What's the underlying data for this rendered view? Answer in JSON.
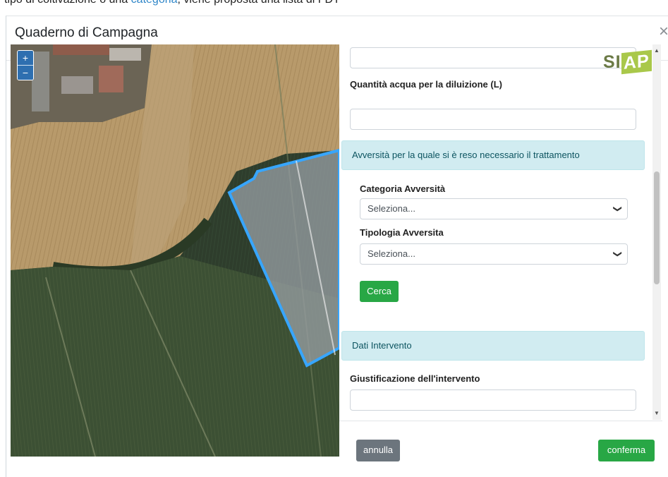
{
  "top_text": {
    "before": "tipo di coltivazione o una ",
    "link": "categoria",
    "after": ", viene proposta una lista di FDT"
  },
  "modal": {
    "title": "Quaderno di Campagna",
    "close_icon": "close-icon"
  },
  "map": {
    "zoom_in": "+",
    "zoom_out": "−"
  },
  "brand": {
    "logo_text_1": "SI",
    "logo_text_2": "AP"
  },
  "form": {
    "top_input_value": "",
    "water_label": "Quantità acqua per la diluizione (L)",
    "water_value": "",
    "adversity_section": "Avversità per la quale si è reso necessario il trattamento",
    "category_label": "Categoria Avversità",
    "category_selected": "Seleziona...",
    "type_label": "Tipologia Avversita",
    "type_selected": "Seleziona...",
    "search_button": "Cerca",
    "intervention_section": "Dati Intervento",
    "justification_label": "Giustificazione dell'intervento",
    "justification_value": ""
  },
  "footer": {
    "cancel": "annulla",
    "confirm": "conferma"
  },
  "colors": {
    "primary_blue": "#2e6fb0",
    "success_green": "#28a745",
    "secondary_grey": "#6c757d",
    "info_bg": "#d1ecf1",
    "parcel_outline": "#37a6ff"
  }
}
